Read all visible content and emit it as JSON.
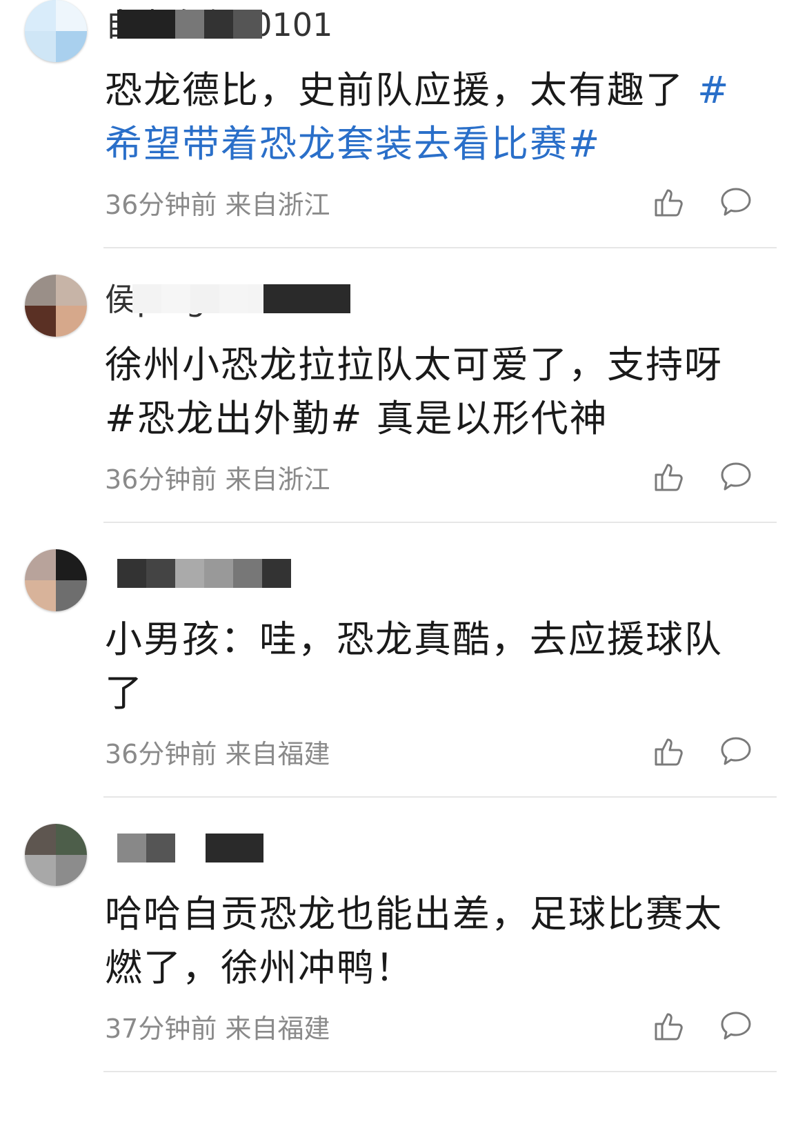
{
  "comments": [
    {
      "username": "自由自在20101",
      "text_parts": [
        {
          "text": "恐龙德比，史前队应援，太有趣了 ",
          "hashtag": false
        },
        {
          "text": "#希望带着恐龙套装去看比赛#",
          "hashtag": true
        }
      ],
      "time": "36分钟前",
      "location": "来自浙江"
    },
    {
      "username": "侯ping",
      "text_parts": [
        {
          "text": "徐州小恐龙拉拉队太可爱了，支持呀 ",
          "hashtag": false
        },
        {
          "text": "#恐龙出外勤#",
          "hashtag": true
        },
        {
          "text": " 真是以形代神",
          "hashtag": false
        }
      ],
      "time": "36分钟前",
      "location": "来自浙江"
    },
    {
      "username": "",
      "text_parts": [
        {
          "text": "小男孩：哇，恐龙真酷，去应援球队了",
          "hashtag": false
        }
      ],
      "time": "36分钟前",
      "location": "来自福建"
    },
    {
      "username": "",
      "text_parts": [
        {
          "text": "哈哈自贡恐龙也能出差，足球比赛太燃了，徐州冲鸭！",
          "hashtag": false
        }
      ],
      "time": "37分钟前",
      "location": "来自福建"
    }
  ],
  "icons": {
    "like": "thumbs-up-icon",
    "reply": "comment-bubble-icon"
  },
  "colors": {
    "hashtag": "#2a6fc9",
    "meta": "#8a8a8a",
    "divider": "#e6e6e6"
  }
}
